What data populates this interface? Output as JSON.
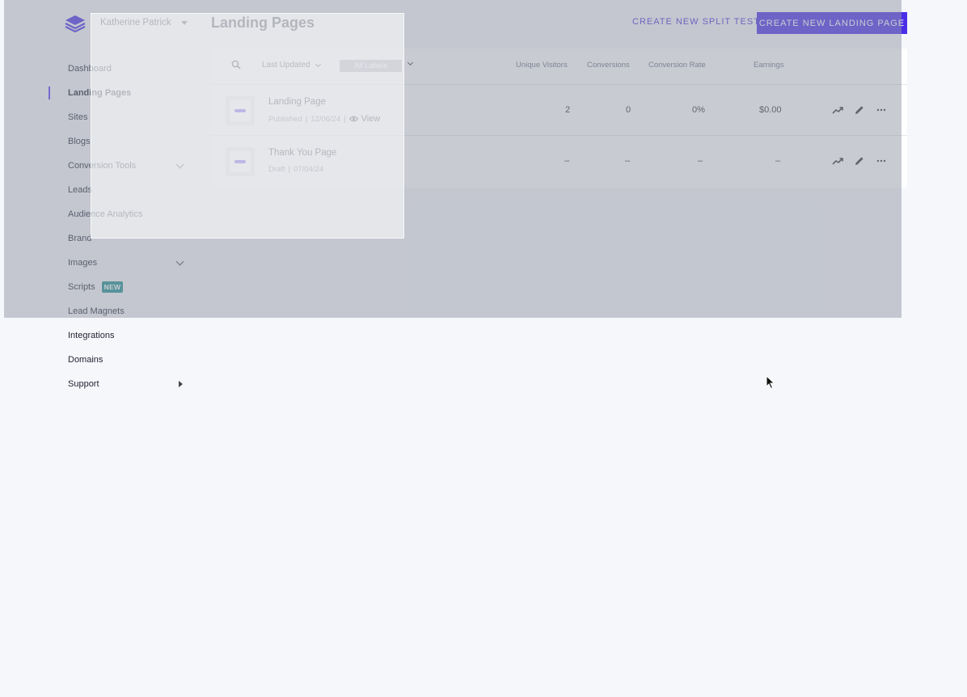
{
  "account": {
    "name": "Katherine Patrick"
  },
  "sidebar": {
    "items": [
      {
        "label": "Dashboard"
      },
      {
        "label": "Landing Pages"
      },
      {
        "label": "Sites"
      },
      {
        "label": "Blogs"
      },
      {
        "label": "Conversion Tools"
      },
      {
        "label": "Leads"
      },
      {
        "label": "Audience Analytics"
      },
      {
        "label": "Brand"
      },
      {
        "label": "Images"
      },
      {
        "label": "Scripts",
        "badge": "NEW"
      },
      {
        "label": "Lead Magnets"
      },
      {
        "label": "Integrations"
      },
      {
        "label": "Domains"
      },
      {
        "label": "Support"
      }
    ]
  },
  "header": {
    "title": "Landing Pages",
    "split_test_label": "CREATE NEW SPLIT TEST",
    "create_label": "CREATE NEW LANDING PAGE"
  },
  "toolbar": {
    "sort_label": "Last Updated",
    "labels_filter": "All Labels"
  },
  "table": {
    "columns": [
      "Unique Visitors",
      "Conversions",
      "Conversion Rate",
      "Earnings"
    ],
    "rows": [
      {
        "name": "Landing Page",
        "status": "Published",
        "date": "12/06/24",
        "view_label": "View",
        "visitors": "2",
        "conversions": "0",
        "rate": "0%",
        "earnings": "$0.00"
      },
      {
        "name": "Thank You Page",
        "status": "Draft",
        "date": "07/04/24",
        "visitors": "–",
        "conversions": "–",
        "rate": "–",
        "earnings": "–"
      }
    ]
  },
  "colors": {
    "accent": "#4b2fe6",
    "badge": "#1e8f8f"
  }
}
